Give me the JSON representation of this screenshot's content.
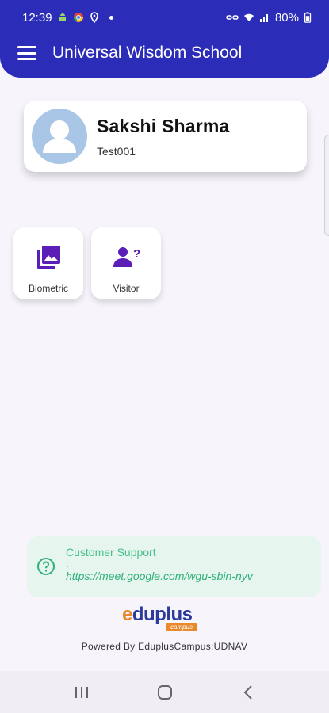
{
  "status_bar": {
    "time": "12:39",
    "battery": "80%"
  },
  "header": {
    "title": "Universal Wisdom School",
    "menu_icon": "hamburger-menu-icon"
  },
  "profile": {
    "name": "Sakshi Sharma",
    "id": "Test001",
    "avatar_icon": "person-avatar-icon"
  },
  "tiles": [
    {
      "label": "Biometric",
      "icon": "photo-library-icon",
      "color": "#5b1fb8"
    },
    {
      "label": "Visitor",
      "icon": "person-question-icon",
      "color": "#5b1fb8"
    }
  ],
  "support": {
    "title": "Customer Support",
    "separator": ".",
    "link": "https://meet.google.com/wgu-sbin-nyv",
    "icon": "help-circle-icon"
  },
  "footer": {
    "logo_text": "eduplus",
    "logo_sub": "campus",
    "powered_by": "Powered By EduplusCampus:UDNAV"
  },
  "colors": {
    "primary": "#2b2db8",
    "accent": "#5b1fb8",
    "support_bg": "#e6f5ed",
    "support_text": "#45c08a"
  },
  "nav": {
    "recent_icon": "recent-apps-icon",
    "home_icon": "home-icon",
    "back_icon": "back-icon"
  }
}
